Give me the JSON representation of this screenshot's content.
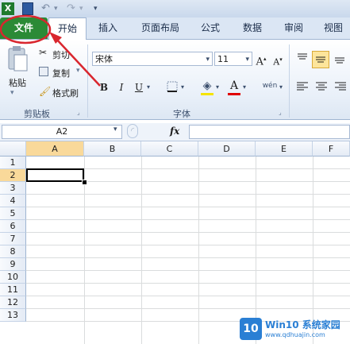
{
  "ribbon_tabs": [
    "文件",
    "开始",
    "插入",
    "页面布局",
    "公式",
    "数据",
    "审阅",
    "视图"
  ],
  "clipboard": {
    "paste": "粘贴",
    "cut": "剪切",
    "copy": "复制",
    "format_painter": "格式刷",
    "group": "剪贴板"
  },
  "font": {
    "name": "宋体",
    "size": "11",
    "group": "字体"
  },
  "formula_bar": {
    "name_box": "A2",
    "fx": "fx",
    "content": ""
  },
  "columns": [
    "A",
    "B",
    "C",
    "D",
    "E",
    "F"
  ],
  "rows": [
    "1",
    "2",
    "3",
    "4",
    "5",
    "6",
    "7",
    "8",
    "9",
    "10",
    "11",
    "12",
    "13"
  ],
  "selected_cell": "A2",
  "watermark": {
    "brand": "Win10 系统家园",
    "url": "www.qdhuajin.com"
  },
  "colors": {
    "file_tab": "#2b8a36",
    "annotation": "#d9262e",
    "selection_header": "#f9d99a"
  }
}
